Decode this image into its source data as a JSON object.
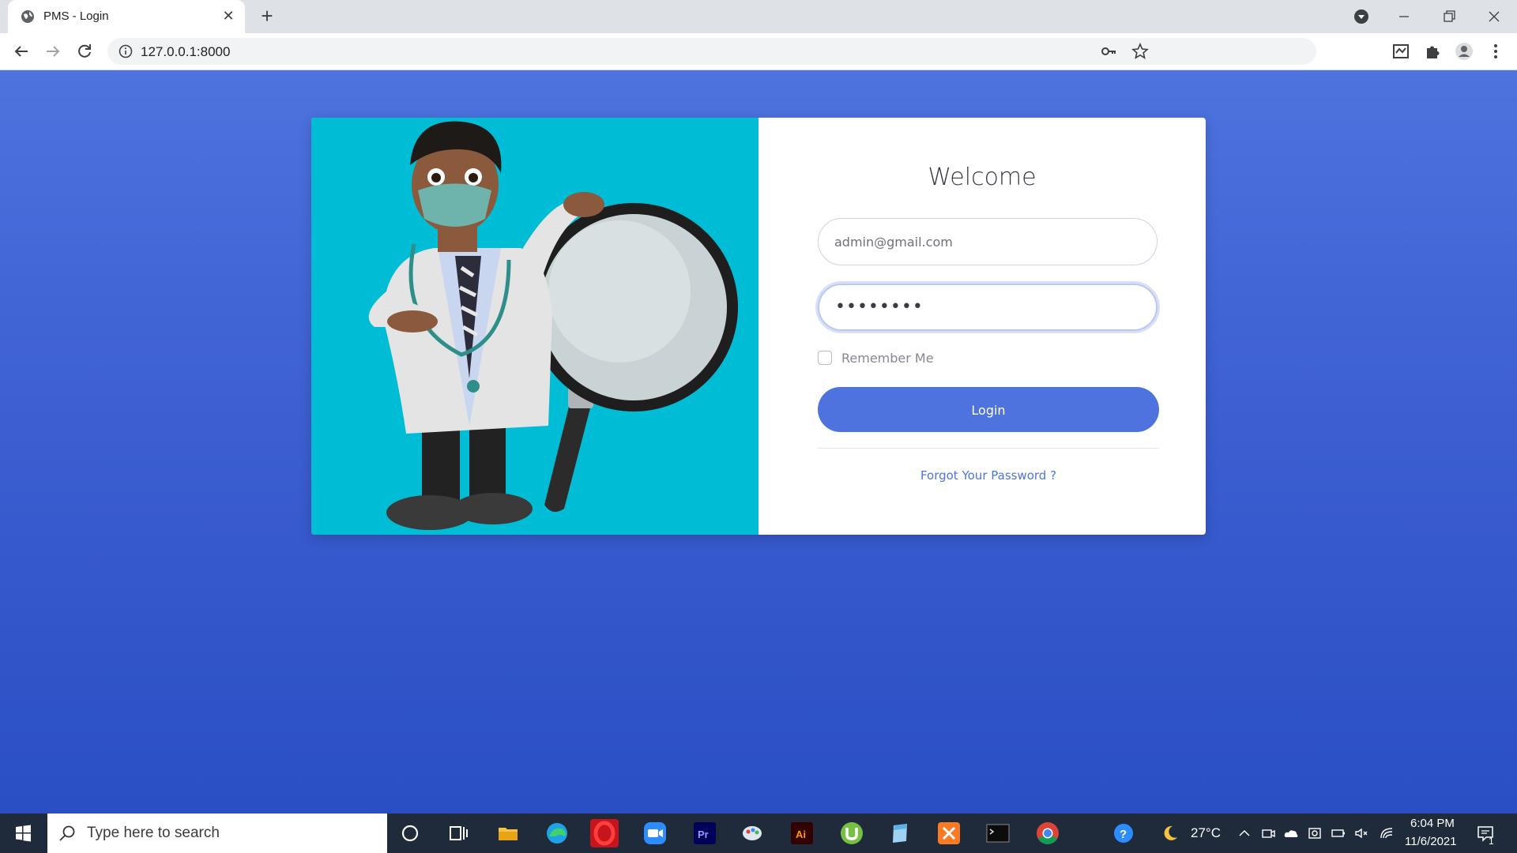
{
  "browser": {
    "tab_title": "PMS - Login",
    "url": "127.0.0.1:8000"
  },
  "login": {
    "heading": "Welcome",
    "email_value": "admin@gmail.com",
    "password_mask": "••••••••",
    "remember_label": "Remember Me",
    "remember_checked": false,
    "login_label": "Login",
    "forgot_label": "Forgot Your Password ?"
  },
  "taskbar": {
    "search_placeholder": "Type here to search",
    "temperature": "27°C",
    "time": "6:04 PM",
    "date": "11/6/2021",
    "notification_count": "1"
  },
  "colors": {
    "page_bg": "#4e73de",
    "illustration_bg": "#00bcd4",
    "accent": "#4e73df",
    "taskbar": "#1f2b3a"
  }
}
